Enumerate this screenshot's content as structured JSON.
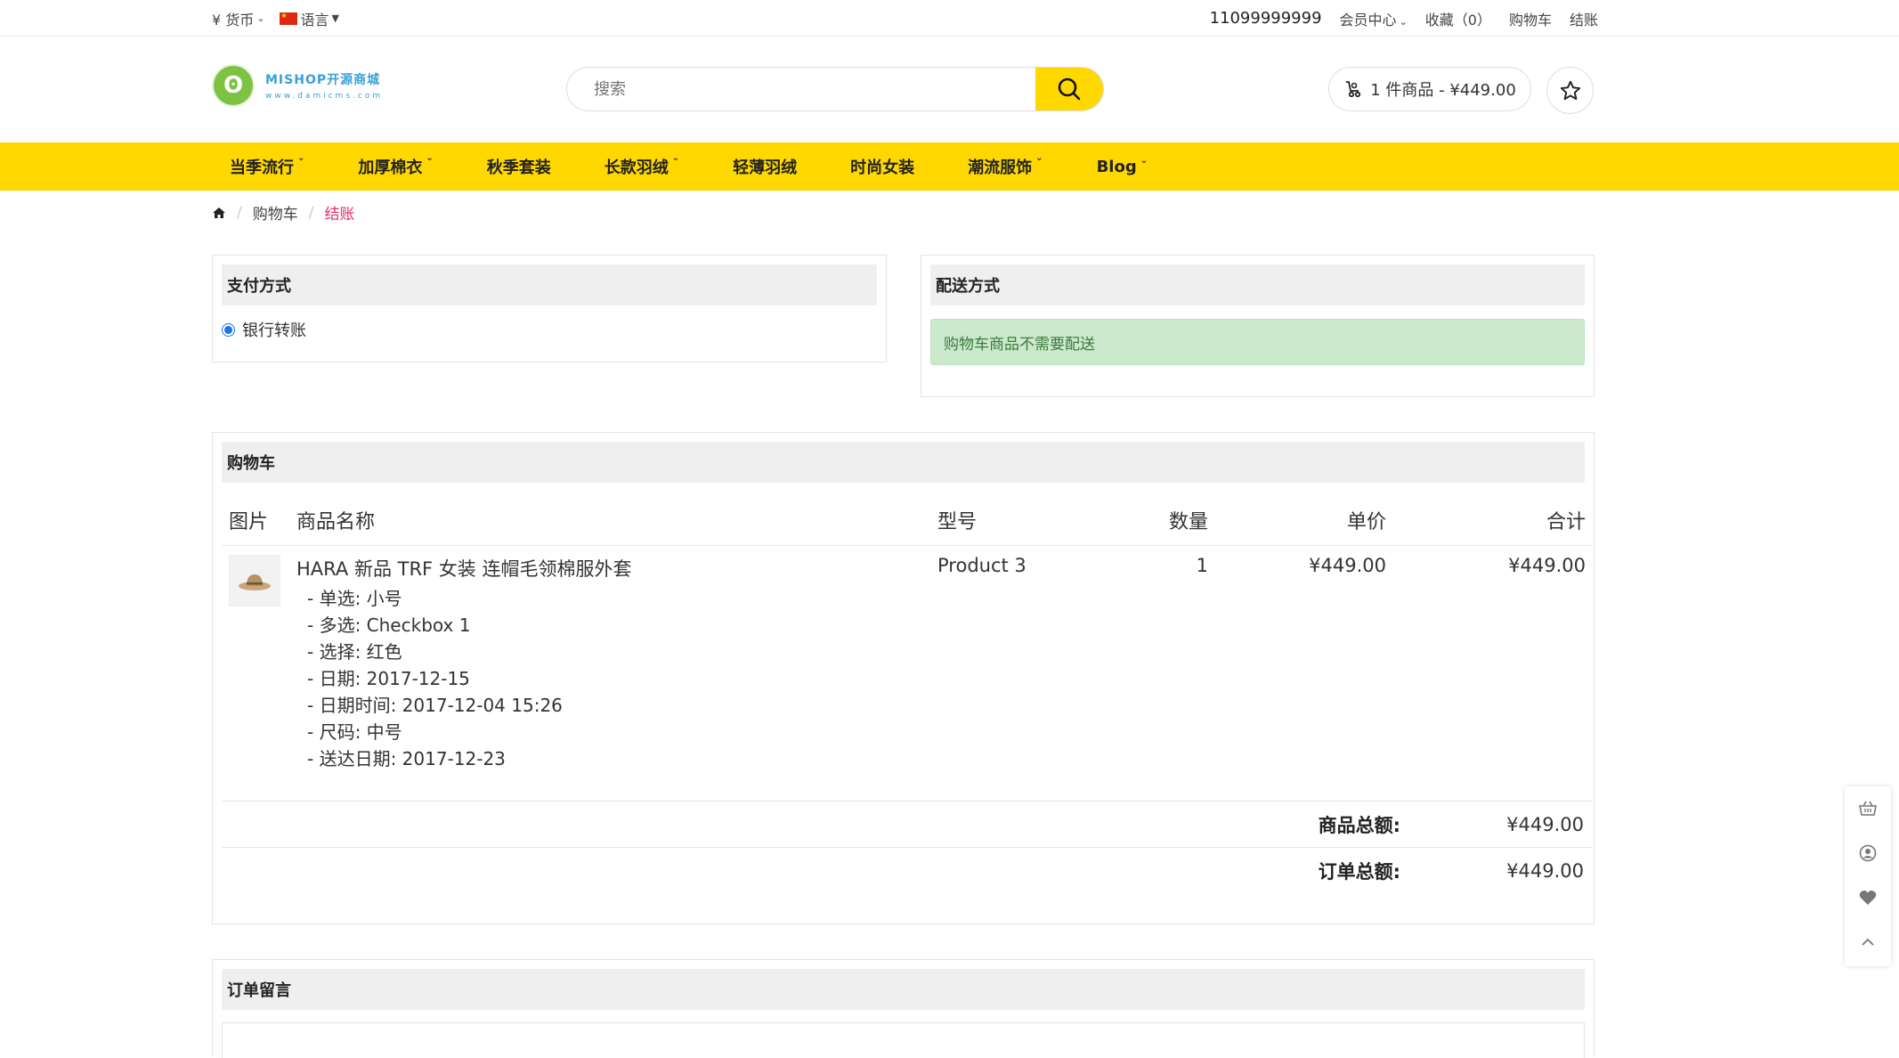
{
  "topbar": {
    "currency": "¥ 货币",
    "language": "语言",
    "phone": "11099999999",
    "member": "会员中心",
    "wishlist": "收藏（0）",
    "cart": "购物车",
    "checkout": "结账"
  },
  "header": {
    "logo_line1": "MISHOP开源商城",
    "logo_line2": "www.damicms.com",
    "search_placeholder": "搜索",
    "cart_summary": "1 件商品 - ¥449.00"
  },
  "nav": [
    "当季流行",
    "加厚棉衣",
    "秋季套装",
    "长款羽绒",
    "轻薄羽绒",
    "时尚女装",
    "潮流服饰",
    "Blog"
  ],
  "breadcrumb": {
    "cart": "购物车",
    "current": "结账"
  },
  "payment": {
    "title": "支付方式",
    "option": "银行转账"
  },
  "shipping": {
    "title": "配送方式",
    "notice": "购物车商品不需要配送"
  },
  "cart": {
    "title": "购物车",
    "columns": {
      "image": "图片",
      "name": "商品名称",
      "model": "型号",
      "qty": "数量",
      "price": "单价",
      "total": "合计"
    },
    "item": {
      "name": "HARA 新品 TRF 女装 连帽毛领棉服外套",
      "options": [
        "- 单选: 小号",
        "- 多选: Checkbox 1",
        "- 选择: 红色",
        "- 日期: 2017-12-15",
        "- 日期时间: 2017-12-04 15:26",
        "- 尺码: 中号",
        "- 送达日期: 2017-12-23"
      ],
      "model": "Product 3",
      "qty": "1",
      "price": "¥449.00",
      "total": "¥449.00"
    },
    "subtotal_label": "商品总额:",
    "subtotal": "¥449.00",
    "grand_label": "订单总额:",
    "grand": "¥449.00"
  },
  "comment": {
    "title": "订单留言"
  },
  "colors": {
    "accent": "#ffd800",
    "breadcrumb_active": "#e5306a",
    "alert_bg": "#cbe9cc"
  }
}
